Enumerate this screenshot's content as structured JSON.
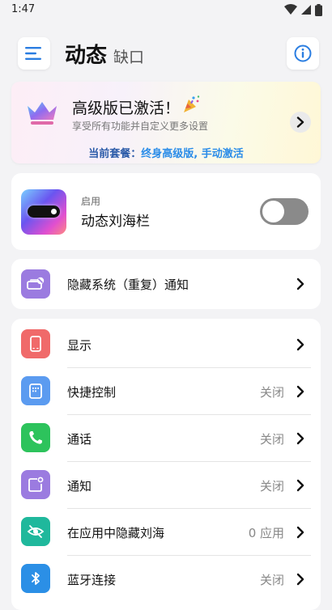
{
  "status": {
    "time": "1:47"
  },
  "header": {
    "title": "动态",
    "subtitle": "缺口"
  },
  "premium": {
    "title": "高级版已激活！",
    "description": "享受所有功能并自定义更多设置",
    "plan_label": "当前套餐：",
    "plan_value": "终身高级版, 手动激活"
  },
  "dynamic_notch": {
    "status_label": "启用",
    "name": "动态刘海栏",
    "enabled": false
  },
  "hide_notification": {
    "label": "隐藏系统（重复）通知",
    "icon": "notification-hide-icon",
    "color": "#9b7be0"
  },
  "settings": [
    {
      "label": "显示",
      "value": "",
      "icon": "display-icon",
      "color": "#f06a6a"
    },
    {
      "label": "快捷控制",
      "value": "关闭",
      "icon": "quick-control-icon",
      "color": "#5b9bf0"
    },
    {
      "label": "通话",
      "value": "关闭",
      "icon": "phone-icon",
      "color": "#2dc35c"
    },
    {
      "label": "通知",
      "value": "关闭",
      "icon": "notification-icon",
      "color": "#9b7be0"
    },
    {
      "label": "在应用中隐藏刘海",
      "value": "0 应用",
      "icon": "eye-off-icon",
      "color": "#1fb89c"
    },
    {
      "label": "蓝牙连接",
      "value": "关闭",
      "icon": "bluetooth-icon",
      "color": "#2b8fe6"
    }
  ]
}
